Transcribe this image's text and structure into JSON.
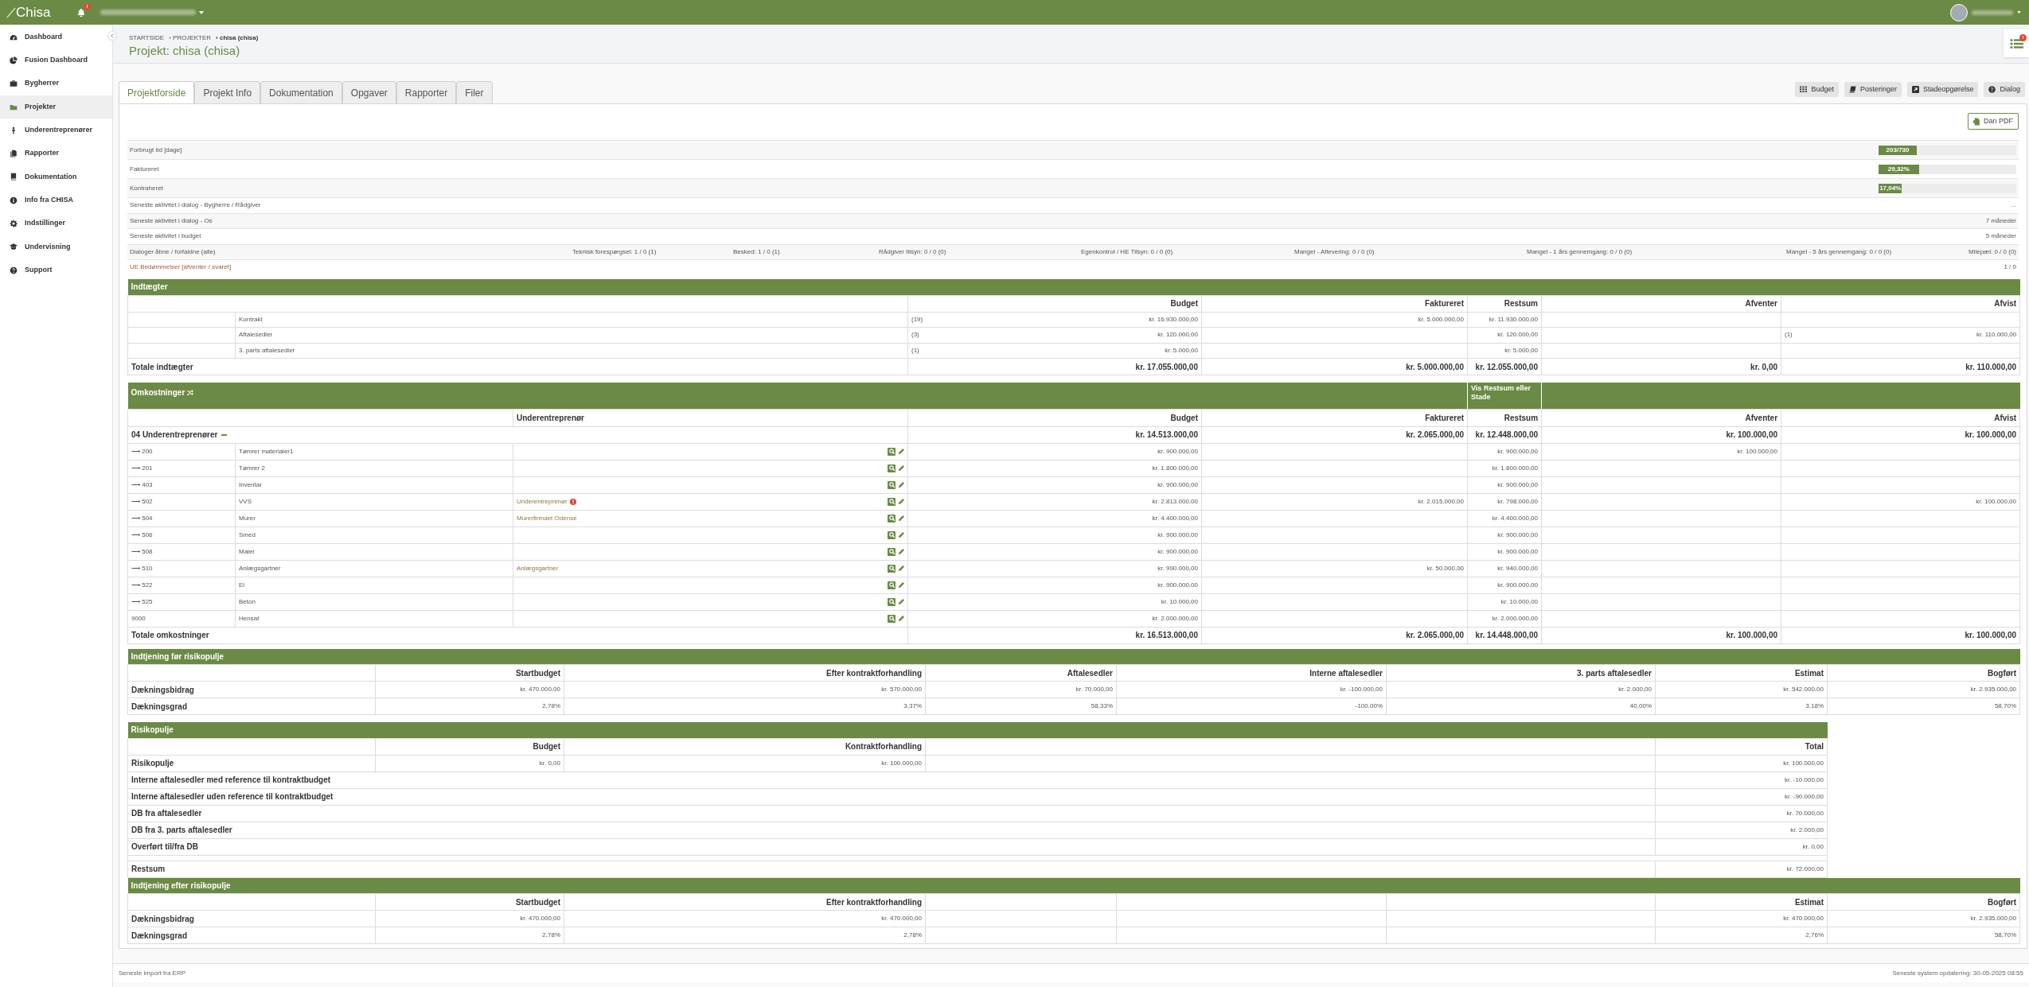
{
  "topbar": {
    "logo": "Chisa",
    "notification_badge": "!"
  },
  "sidebar": {
    "items": [
      {
        "label": "Dashboard",
        "selected": false
      },
      {
        "label": "Fusion Dashboard",
        "selected": false
      },
      {
        "label": "Bygherrer",
        "selected": false
      },
      {
        "label": "Projekter",
        "selected": true
      },
      {
        "label": "Underentreprenører",
        "selected": false
      },
      {
        "label": "Rapporter",
        "selected": false
      },
      {
        "label": "Dokumentation",
        "selected": false
      },
      {
        "label": "Info fra CHISA",
        "selected": false
      },
      {
        "label": "Indstillinger",
        "selected": false
      },
      {
        "label": "Undervisning",
        "selected": false
      },
      {
        "label": "Support",
        "selected": false
      }
    ]
  },
  "breadcrumb": [
    "STARTSIDE",
    "› PROJEKTER",
    "› chisa (chisa)"
  ],
  "title": "Projekt: chisa (chisa)",
  "tasks_badge": "!",
  "tabs": [
    {
      "label": "Projektforside",
      "selected": true
    },
    {
      "label": "Projekt Info",
      "selected": false
    },
    {
      "label": "Dokumentation",
      "selected": false
    },
    {
      "label": "Opgaver",
      "selected": false
    },
    {
      "label": "Rapporter",
      "selected": false
    },
    {
      "label": "Filer",
      "selected": false
    }
  ],
  "toolbar_buttons": [
    "Budget",
    "Posteringer",
    "Stadeopgørelse",
    "Dialog"
  ],
  "pdf_button": "Dan PDF",
  "progress_rows": [
    {
      "label": "Forbrugt tid [dage]",
      "reading": "203/730",
      "level": 0.278
    },
    {
      "label": "Faktureret",
      "reading": "29,32%",
      "level": 0.2932
    },
    {
      "label": "Kontraheret",
      "reading": "17,04%",
      "level": 0.1704
    }
  ],
  "activity_rows": [
    {
      "label": "Seneste aktivitet i dialog - Bygherre / Rådgiver",
      "value": "..."
    },
    {
      "label": "Seneste aktivitet i dialog - Os",
      "value": "7 måneder"
    },
    {
      "label": "Seneste aktivitet i budget",
      "value": "5 måneder"
    }
  ],
  "dialog_row": {
    "label": "Dialoger åbne / forfaldne (alle)",
    "items": [
      "Teknisk forespørgsel: 1 / 0 (1)",
      "Besked: 1 / 0 (1)",
      "Rådgiver tilsyn: 0 / 0 (0)",
      "Egenkontrol / HE Tilsyn: 0 / 0 (0)",
      "Mangel - Aflevering: 0 / 0 (0)",
      "Mangel - 1 års gennemgang: 0 / 0 (0)",
      "Mangel - 5 års gennemgang: 0 / 0 (0)",
      "Milepæl: 0 / 0 (0)"
    ]
  },
  "ue_row": {
    "label": "UE Bedømmelser [afventer / svaret]",
    "value": "1 / 0"
  },
  "income": {
    "title": "Indtægter",
    "columns": [
      "Budget",
      "Faktureret",
      "Restsum",
      "Afventer",
      "Afvist"
    ],
    "rows": [
      {
        "label": "Kontrakt",
        "count": "(19)",
        "budget": "kr. 16.930.000,00",
        "faktureret": "kr. 5.000.000,00",
        "restsum": "kr. 11.930.000,00"
      },
      {
        "label": "Aftalesedler",
        "count": "(3)",
        "budget": "kr. 120.000,00",
        "restsum": "kr. 120.000,00",
        "afvist_count": "(1)",
        "afvist": "kr. 110.000,00"
      },
      {
        "label": "3. parts aftalesedler",
        "count": "(1)",
        "budget": "kr. 5.000,00",
        "restsum": "kr. 5.000,00"
      }
    ],
    "total": {
      "label": "Totale indtægter",
      "budget": "kr. 17.055.000,00",
      "faktureret": "kr. 5.000.000,00",
      "restsum": "kr. 12.055.000,00",
      "afventer": "kr. 0,00",
      "afvist": "kr. 110.000,00"
    }
  },
  "costs": {
    "title": "Omkostninger",
    "toggle_label": "Vis Restsum eller Stade",
    "sub_column": "Underentreprenør",
    "columns": [
      "Budget",
      "Faktureret",
      "Restsum",
      "Afventer",
      "Afvist"
    ],
    "group": {
      "label": "04 Underentreprenører",
      "expanded": true,
      "budget": "kr. 14.513.000,00",
      "faktureret": "kr. 2.065.000,00",
      "restsum": "kr. 12.448.000,00",
      "afventer": "kr. 100.000,00",
      "afvist": "kr. 100.000,00",
      "children": [
        {
          "number": "⟶ 200",
          "name": "Tømrer materialer1",
          "warning": false,
          "budget": "kr. 900.000,00",
          "restsum": "kr. 900.000,00",
          "afventer": "kr. 100.000,00"
        },
        {
          "number": "⟶ 201",
          "name": "Tømrer 2",
          "warning": false,
          "budget": "kr. 1.800.000,00",
          "restsum": "kr. 1.800.000,00"
        },
        {
          "number": "⟶ 403",
          "name": "Inventar",
          "warning": false,
          "budget": "kr. 900.000,00",
          "restsum": "kr. 900.000,00"
        },
        {
          "number": "⟶ 502",
          "name": "VVS",
          "subcontractor": "Underentreprenør",
          "warning": true,
          "budget": "kr. 2.813.000,00",
          "faktureret": "kr. 2.015.000,00",
          "restsum": "kr. 798.000,00",
          "afvist": "kr. 100.000,00"
        },
        {
          "number": "⟶ 504",
          "name": "Murer",
          "subcontractor": "Murerfirmaet Odense",
          "warning": false,
          "budget": "kr. 4.400.000,00",
          "restsum": "kr. 4.400.000,00"
        },
        {
          "number": "⟶ 506",
          "name": "Smed",
          "warning": false,
          "budget": "kr. 900.000,00",
          "restsum": "kr. 900.000,00"
        },
        {
          "number": "⟶ 508",
          "name": "Maler",
          "warning": false,
          "budget": "kr. 900.000,00",
          "restsum": "kr. 900.000,00"
        },
        {
          "number": "⟶ 510",
          "name": "Anlægsgartner",
          "subcontractor": "Anlægsgartner",
          "warning": false,
          "budget": "kr. 990.000,00",
          "faktureret": "kr. 50.000,00",
          "restsum": "kr. 940.000,00"
        },
        {
          "number": "⟶ 522",
          "name": "El",
          "warning": false,
          "budget": "kr. 900.000,00",
          "restsum": "kr. 900.000,00"
        },
        {
          "number": "⟶ 525",
          "name": "Beton",
          "warning": false,
          "budget": "kr. 10.000,00",
          "restsum": "kr. 10.000,00"
        },
        {
          "number": "9000",
          "name": "Hensat",
          "warning": false,
          "budget": "kr. 2.000.000,00",
          "restsum": "kr. 2.000.000,00"
        }
      ]
    },
    "total": {
      "label": "Totale omkostninger",
      "budget": "kr. 16.513.000,00",
      "faktureret": "kr. 2.065.000,00",
      "restsum": "kr. 14.448.000,00",
      "afventer": "kr. 100.000,00",
      "afvist": "kr. 100.000,00"
    }
  },
  "earnings_before": {
    "title": "Indtjening før risikopulje",
    "columns": {
      "startbudget": "Startbudget",
      "efter_kontraktforhandling": "Efter kontraktforhandling",
      "aftalesedler": "Aftalesedler",
      "interne_aftalesedler": "Interne aftalesedler",
      "tredjeparts_aftalesedler": "3. parts aftalesedler",
      "estimat": "Estimat",
      "bogfort": "Bogført"
    },
    "rows": [
      {
        "label": "Dækningsbidrag",
        "values": {
          "startbudget": "kr. 470.000,00",
          "efter_kontraktforhandling": "kr. 570.000,00",
          "aftalesedler": "kr. 70.000,00",
          "interne_aftalesedler": "kr. -100.000,00",
          "tredjeparts_aftalesedler": "kr. 2.000,00",
          "estimat": "kr. 542.000,00",
          "bogfort": "kr. 2.935.000,00"
        }
      },
      {
        "label": "Dækningsgrad",
        "values": {
          "startbudget": "2,78%",
          "efter_kontraktforhandling": "3,37%",
          "aftalesedler": "58,33%",
          "interne_aftalesedler": "-100,00%",
          "tredjeparts_aftalesedler": "40,00%",
          "estimat": "3,18%",
          "bogfort": "58,70%"
        }
      }
    ]
  },
  "risk_pool": {
    "title": "Risikopulje",
    "columns": [
      "Budget",
      "Kontraktforhandling",
      "Total"
    ],
    "first_row": {
      "label": "Risikopulje",
      "budget": "kr. 0,00",
      "kontrakt": "kr. 100.000,00",
      "total": "kr. 100.000,00"
    },
    "rows": [
      {
        "label": "Interne aftalesedler med reference til kontraktbudget",
        "total": "kr. -10.000,00"
      },
      {
        "label": "Interne aftalesedler uden reference til kontraktbudget",
        "total": "kr. -90.000,00"
      },
      {
        "label": "DB fra aftalesedler",
        "total": "kr. 70.000,00"
      },
      {
        "label": "DB fra 3. parts aftalesedler",
        "total": "kr. 2.000,00"
      },
      {
        "label": "Overført til/fra DB",
        "total": "kr. 0,00"
      }
    ],
    "restsum": {
      "label": "Restsum",
      "total": "kr. 72.000,00"
    }
  },
  "earnings_after": {
    "title": "Indtjening efter risikopulje",
    "columns": {
      "startbudget": "Startbudget",
      "efter_kontraktforhandling": "Efter kontraktforhandling",
      "estimat": "Estimat",
      "bogfort": "Bogført"
    },
    "rows": [
      {
        "label": "Dækningsbidrag",
        "values": {
          "startbudget": "kr. 470.000,00",
          "efter_kontraktforhandling": "kr. 470.000,00",
          "estimat": "kr. 470.000,00",
          "bogfort": "kr. 2.935.000,00"
        }
      },
      {
        "label": "Dækningsgrad",
        "values": {
          "startbudget": "2,78%",
          "efter_kontraktforhandling": "2,78%",
          "estimat": "2,76%",
          "bogfort": "58,70%"
        }
      }
    ]
  },
  "footer": {
    "left": "Seneste import fra ERP",
    "right": "Seneste system opdatering: 30-05-2025 08:55"
  }
}
